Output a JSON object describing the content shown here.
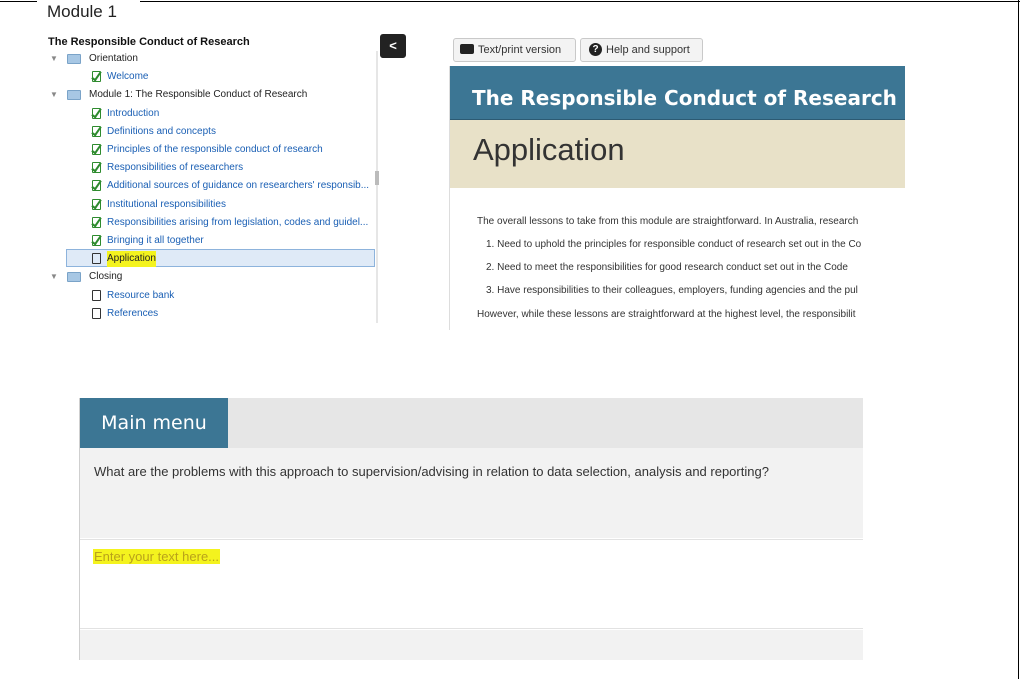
{
  "document": {
    "title": "Module 1"
  },
  "course_tree": {
    "title": "The Responsible Conduct of Research",
    "collapse_label": "<",
    "nodes": [
      {
        "label": "Orientation",
        "type": "folder",
        "level": 0,
        "expanded": true
      },
      {
        "label": "Welcome",
        "type": "page",
        "status": "completed",
        "level": 1
      },
      {
        "label": "Module 1: The Responsible Conduct of Research",
        "type": "folder",
        "level": 0,
        "expanded": true
      },
      {
        "label": "Introduction",
        "type": "page",
        "status": "completed",
        "level": 1
      },
      {
        "label": "Definitions and concepts",
        "type": "page",
        "status": "completed",
        "level": 1
      },
      {
        "label": "Principles of the responsible conduct of research",
        "type": "page",
        "status": "completed",
        "level": 1
      },
      {
        "label": "Responsibilities of researchers",
        "type": "page",
        "status": "completed",
        "level": 1
      },
      {
        "label": "Additional sources of guidance on researchers' responsib...",
        "type": "page",
        "status": "completed",
        "level": 1
      },
      {
        "label": "Institutional responsibilities",
        "type": "page",
        "status": "completed",
        "level": 1
      },
      {
        "label": "Responsibilities arising from legislation, codes and guidel...",
        "type": "page",
        "status": "completed",
        "level": 1
      },
      {
        "label": "Bringing it all together",
        "type": "page",
        "status": "completed",
        "level": 1
      },
      {
        "label": "Application",
        "type": "page",
        "status": "current",
        "level": 1,
        "selected": true
      },
      {
        "label": "Closing",
        "type": "folder",
        "level": 0,
        "expanded": true
      },
      {
        "label": "Resource bank",
        "type": "page",
        "status": "not-started",
        "level": 1
      },
      {
        "label": "References",
        "type": "page",
        "status": "not-started",
        "level": 1
      }
    ]
  },
  "preview": {
    "toolbar": {
      "text_print_label": "Text/print version",
      "help_label": "Help and support"
    },
    "header_title": "The Responsible Conduct of Research",
    "page_title": "Application",
    "intro": "The overall lessons to take from this module are straightforward. In Australia, research",
    "list": [
      "1. Need to uphold the principles for responsible conduct of research set out in the Co",
      "2. Need to meet the responsibilities for good research conduct set out in the Code",
      "3. Have responsibilities to their colleagues, employers, funding agencies and the pul"
    ],
    "outro": "However, while these lessons are straightforward at the highest level, the responsibilit",
    "colors": {
      "header": "#3c7694",
      "band": "#e8e1c8"
    }
  },
  "activity": {
    "menu_label": "Main menu",
    "question": "What are the problems with this approach to supervision/advising in relation to data selection, analysis and reporting?",
    "answer_placeholder": "Enter your text here...",
    "highlight_color": "#f4f31e"
  }
}
